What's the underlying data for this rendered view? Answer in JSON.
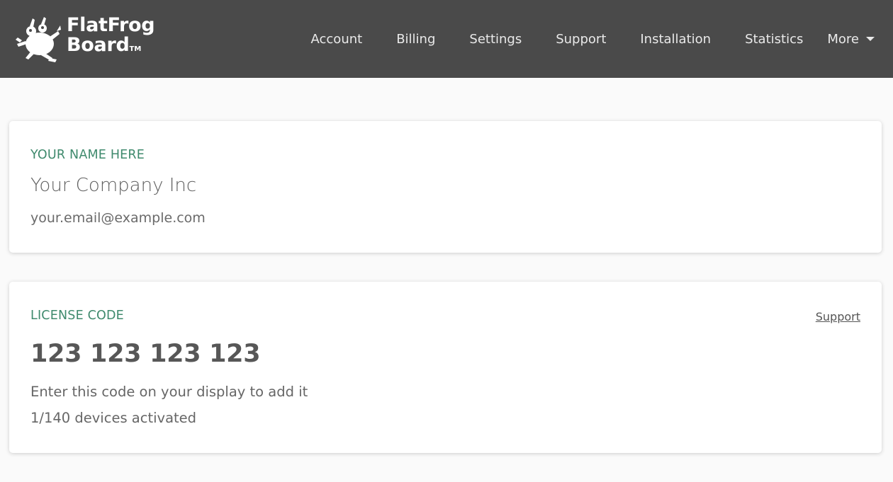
{
  "brand": {
    "line1": "FlatFrog",
    "line2": "Board",
    "tm": "TM"
  },
  "nav": {
    "items": [
      "Account",
      "Billing",
      "Settings",
      "Support",
      "Installation",
      "Statistics"
    ],
    "more": "More"
  },
  "user_card": {
    "label": "YOUR NAME HERE",
    "company": "Your Company Inc",
    "email": "your.email@example.com"
  },
  "license_card": {
    "label": "LICENSE CODE",
    "support_link": "Support",
    "code": "123 123 123 123",
    "hint": "Enter this code on your display to add it",
    "devices": "1/140 devices activated"
  },
  "colors": {
    "navbar": "#4a4a4a",
    "accent": "#3f8a6d",
    "background": "#fafafa"
  },
  "icons": {
    "logo": "frog-icon",
    "more": "caret-down-icon"
  }
}
